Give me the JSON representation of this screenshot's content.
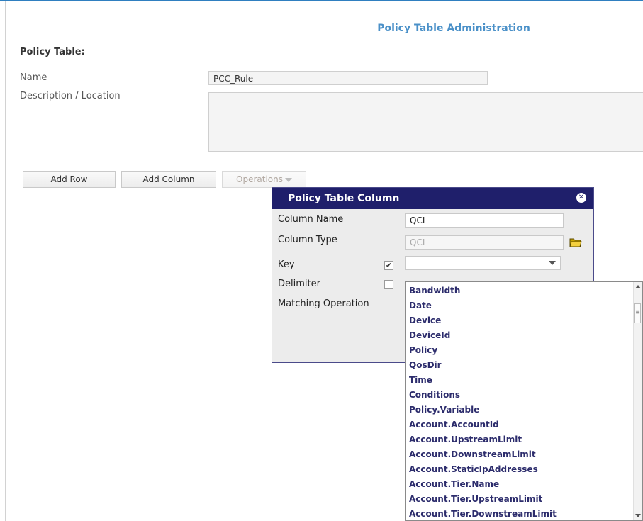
{
  "page": {
    "title": "Policy Table Administration",
    "section_label": "Policy Table:",
    "name_label": "Name",
    "name_value": "PCC_Rule",
    "description_label": "Description / Location"
  },
  "toolbar": {
    "add_row": "Add Row",
    "add_column": "Add Column",
    "operations": "Operations"
  },
  "dialog": {
    "title": "Policy Table Column",
    "column_name_label": "Column Name",
    "column_name_value": "QCI",
    "column_type_label": "Column Type",
    "column_type_value": "QCI",
    "key_label": "Key",
    "key_checked": true,
    "key_check_glyph": "✔",
    "delimiter_label": "Delimiter",
    "delimiter_checked": false,
    "matching_operation_label": "Matching Operation",
    "close_glyph": "✕"
  },
  "dropdown": {
    "items": [
      "Bandwidth",
      "Date",
      "Device",
      "DeviceId",
      "Policy",
      "QosDir",
      "Time",
      "Conditions",
      "Policy.Variable",
      "Account.AccountId",
      "Account.UpstreamLimit",
      "Account.DownstreamLimit",
      "Account.StaticIpAddresses",
      "Account.Tier.Name",
      "Account.Tier.UpstreamLimit",
      "Account.Tier.DownstreamLimit"
    ],
    "scroll_thumb_glyph": "≡"
  },
  "colors": {
    "accent": "#2f7fc0",
    "dialog_header": "#1f1f6b",
    "dropdown_text": "#2c2c6c"
  },
  "icons": {
    "folder": "folder-open-icon",
    "close": "close-circle-icon"
  }
}
